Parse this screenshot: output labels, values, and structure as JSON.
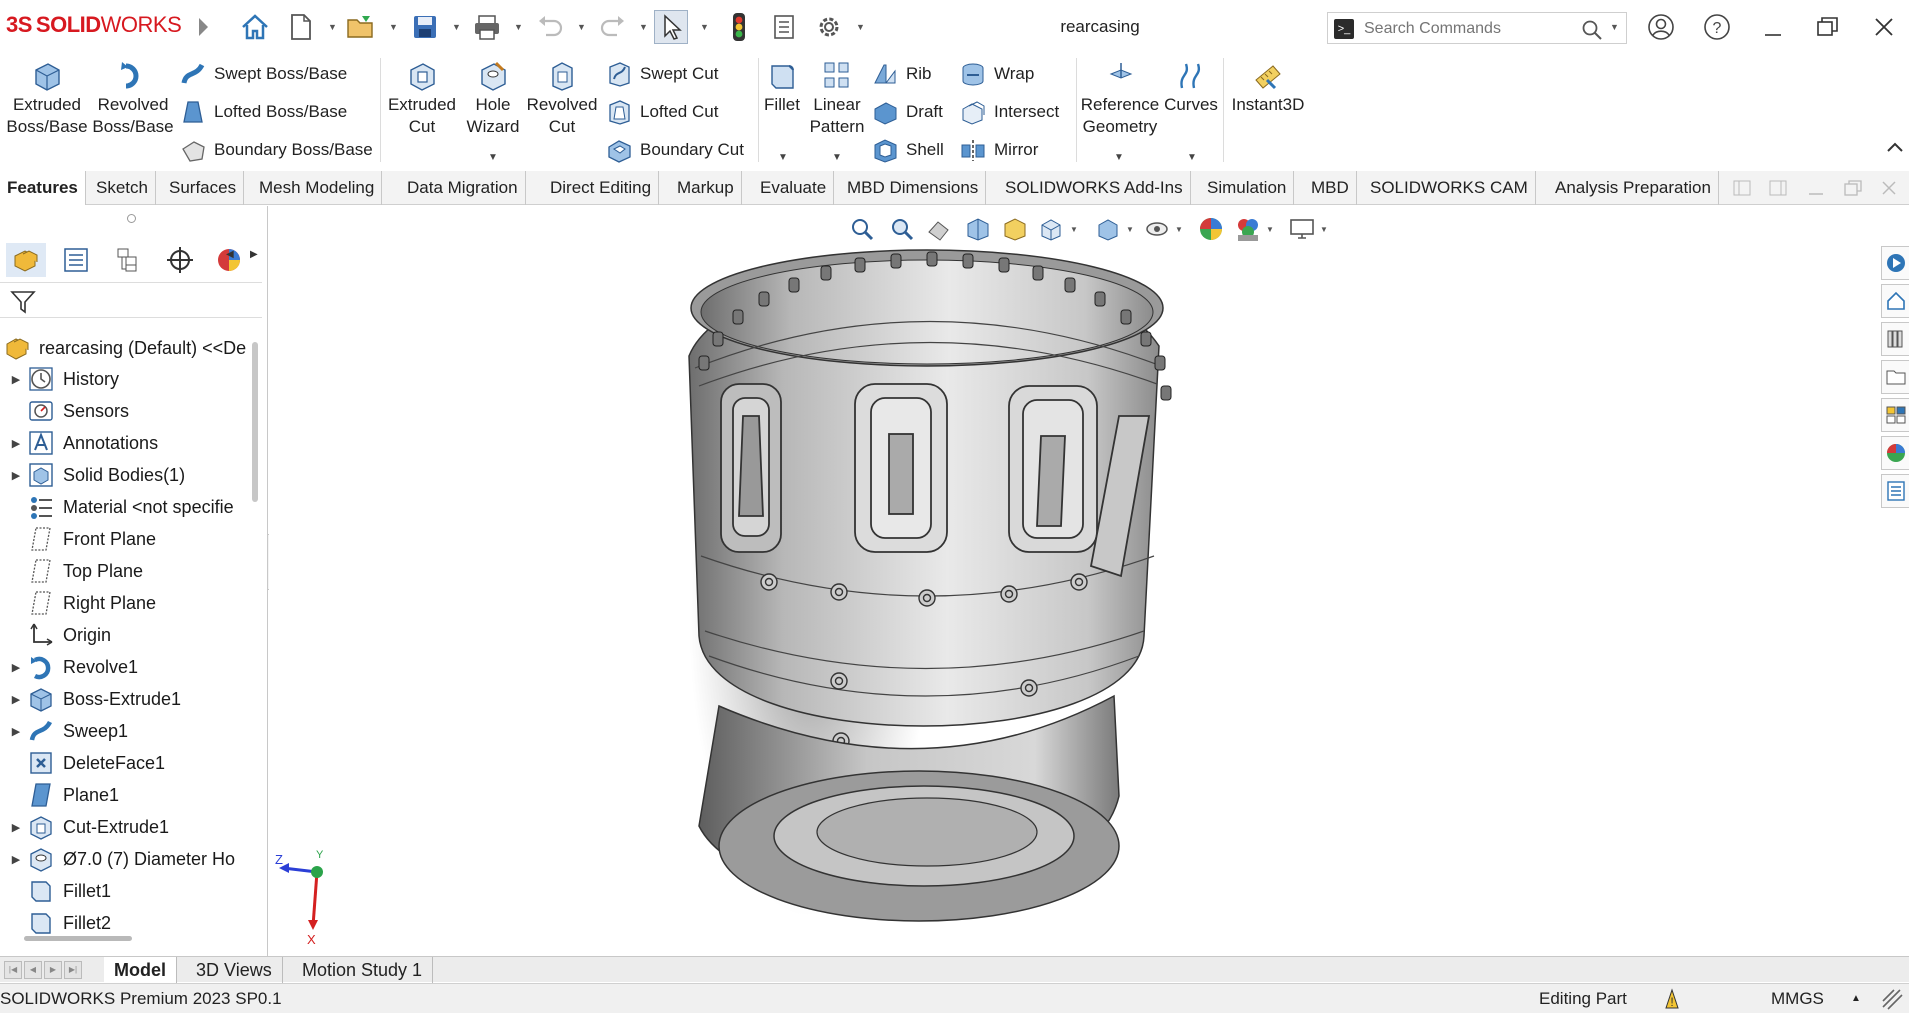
{
  "app": {
    "logo_ds": "3S",
    "logo_solid": "SOLID",
    "logo_works": "WORKS",
    "document_title": "rearcasing"
  },
  "search": {
    "placeholder": "Search Commands"
  },
  "ribbon": {
    "extruded_boss": [
      "Extruded",
      "Boss/Base"
    ],
    "revolved_boss": [
      "Revolved",
      "Boss/Base"
    ],
    "swept_boss": "Swept Boss/Base",
    "lofted_boss": "Lofted Boss/Base",
    "boundary_boss": "Boundary Boss/Base",
    "extruded_cut": [
      "Extruded",
      "Cut"
    ],
    "hole_wizard": [
      "Hole",
      "Wizard"
    ],
    "revolved_cut": [
      "Revolved",
      "Cut"
    ],
    "swept_cut": "Swept Cut",
    "lofted_cut": "Lofted Cut",
    "boundary_cut": "Boundary Cut",
    "fillet": "Fillet",
    "linear_pattern": [
      "Linear",
      "Pattern"
    ],
    "rib": "Rib",
    "draft": "Draft",
    "shell": "Shell",
    "wrap": "Wrap",
    "intersect": "Intersect",
    "mirror": "Mirror",
    "reference_geometry": [
      "Reference",
      "Geometry"
    ],
    "curves": "Curves",
    "instant3d": "Instant3D"
  },
  "command_tabs": [
    "Features",
    "Sketch",
    "Surfaces",
    "Mesh Modeling",
    "Data Migration",
    "Direct Editing",
    "Markup",
    "Evaluate",
    "MBD Dimensions",
    "SOLIDWORKS Add-Ins",
    "Simulation",
    "MBD",
    "SOLIDWORKS CAM",
    "Analysis Preparation"
  ],
  "tree": {
    "root": "rearcasing (Default) <<De",
    "items": [
      {
        "label": "History",
        "icon": "history-icon",
        "expand": true
      },
      {
        "label": "Sensors",
        "icon": "sensor-icon",
        "expand": false
      },
      {
        "label": "Annotations",
        "icon": "annotation-icon",
        "expand": true
      },
      {
        "label": "Solid Bodies(1)",
        "icon": "solid-bodies-icon",
        "expand": true
      },
      {
        "label": "Material <not specifie",
        "icon": "material-icon",
        "expand": false
      },
      {
        "label": "Front Plane",
        "icon": "plane-icon",
        "expand": false
      },
      {
        "label": "Top Plane",
        "icon": "plane-icon",
        "expand": false
      },
      {
        "label": "Right Plane",
        "icon": "plane-icon",
        "expand": false
      },
      {
        "label": "Origin",
        "icon": "origin-icon",
        "expand": false
      },
      {
        "label": "Revolve1",
        "icon": "revolve-icon",
        "expand": true
      },
      {
        "label": "Boss-Extrude1",
        "icon": "extrude-icon",
        "expand": true
      },
      {
        "label": "Sweep1",
        "icon": "sweep-icon",
        "expand": true
      },
      {
        "label": "DeleteFace1",
        "icon": "delete-face-icon",
        "expand": false
      },
      {
        "label": "Plane1",
        "icon": "plane-feature-icon",
        "expand": false
      },
      {
        "label": "Cut-Extrude1",
        "icon": "cut-extrude-icon",
        "expand": true
      },
      {
        "label": "Ø7.0 (7) Diameter Ho",
        "icon": "hole-icon",
        "expand": true
      },
      {
        "label": "Fillet1",
        "icon": "fillet-icon",
        "expand": false
      },
      {
        "label": "Fillet2",
        "icon": "fillet-icon",
        "expand": false
      }
    ]
  },
  "triad": {
    "z": "Z",
    "y": "Y",
    "x": "X"
  },
  "bottom_tabs": [
    "Model",
    "3D Views",
    "Motion Study 1"
  ],
  "status": {
    "product": "SOLIDWORKS Premium 2023 SP0.1",
    "mode": "Editing Part",
    "units": "MMGS"
  },
  "colors": {
    "brand": "#d71920",
    "accent_blue": "#2e75b6"
  }
}
